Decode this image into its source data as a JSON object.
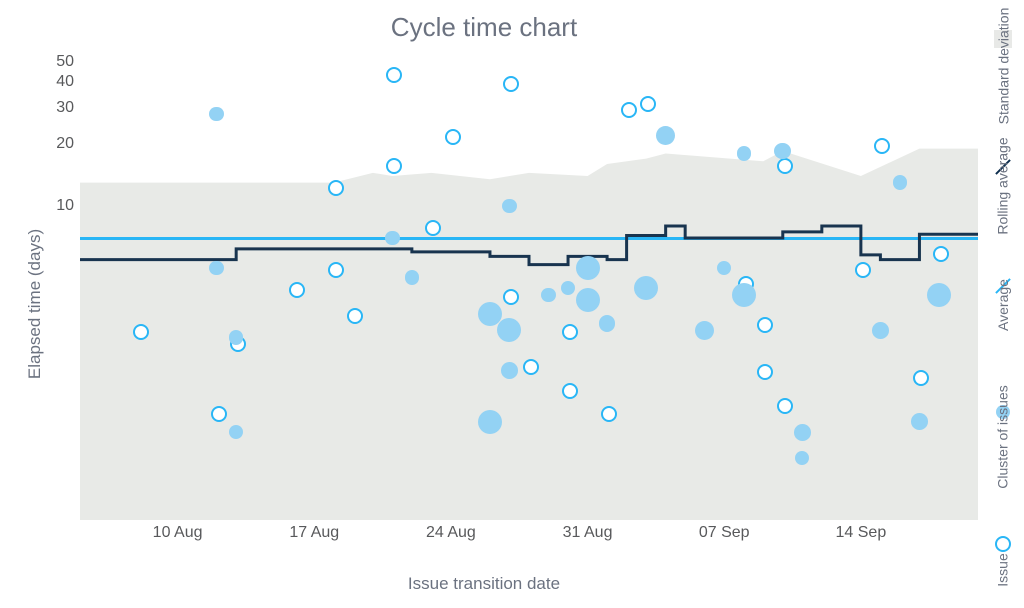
{
  "title": "Cycle time chart",
  "xlabel": "Issue transition date",
  "ylabel": "Elapsed time (days)",
  "legend": {
    "std": "Standard deviation",
    "ra": "Rolling average",
    "avg": "Average",
    "clu": "Cluster of issues",
    "iss": "Issue"
  },
  "x_ticks": [
    "10 Aug",
    "17 Aug",
    "24 Aug",
    "31 Aug",
    "07 Sep",
    "14 Sep"
  ],
  "y_ticks": [
    10,
    20,
    30,
    40,
    50
  ],
  "chart_data": {
    "type": "scatter",
    "title": "Cycle time chart",
    "xlabel": "Issue transition date",
    "ylabel": "Elapsed time (days)",
    "ylim": [
      0,
      50
    ],
    "x_domain": [
      "05 Aug",
      "20 Sep"
    ],
    "average": 7,
    "rolling_average": [
      {
        "x": "05 Aug",
        "y": 5.5
      },
      {
        "x": "12 Aug",
        "y": 5.5
      },
      {
        "x": "13 Aug",
        "y": 6.2
      },
      {
        "x": "22 Aug",
        "y": 6.0
      },
      {
        "x": "23 Aug",
        "y": 6.0
      },
      {
        "x": "26 Aug",
        "y": 5.7
      },
      {
        "x": "28 Aug",
        "y": 5.2
      },
      {
        "x": "30 Aug",
        "y": 5.7
      },
      {
        "x": "01 Sep",
        "y": 5.5
      },
      {
        "x": "02 Sep",
        "y": 7.2
      },
      {
        "x": "03 Sep",
        "y": 7.2
      },
      {
        "x": "04 Sep",
        "y": 8.0
      },
      {
        "x": "05 Sep",
        "y": 7.0
      },
      {
        "x": "10 Sep",
        "y": 7.5
      },
      {
        "x": "12 Sep",
        "y": 8.0
      },
      {
        "x": "14 Sep",
        "y": 5.8
      },
      {
        "x": "15 Sep",
        "y": 5.5
      },
      {
        "x": "17 Sep",
        "y": 7.3
      },
      {
        "x": "20 Sep",
        "y": 7.3
      }
    ],
    "std_band_upper": [
      {
        "x": "05 Aug",
        "y": 13
      },
      {
        "x": "18 Aug",
        "y": 13
      },
      {
        "x": "20 Aug",
        "y": 14.5
      },
      {
        "x": "21 Aug",
        "y": 14
      },
      {
        "x": "23 Aug",
        "y": 14.5
      },
      {
        "x": "26 Aug",
        "y": 13.5
      },
      {
        "x": "28 Aug",
        "y": 14.5
      },
      {
        "x": "31 Aug",
        "y": 14
      },
      {
        "x": "01 Sep",
        "y": 16
      },
      {
        "x": "03 Sep",
        "y": 17
      },
      {
        "x": "04 Sep",
        "y": 18
      },
      {
        "x": "09 Sep",
        "y": 16.5
      },
      {
        "x": "10 Sep",
        "y": 18.5
      },
      {
        "x": "14 Sep",
        "y": 14
      },
      {
        "x": "17 Sep",
        "y": 19
      },
      {
        "x": "20 Sep",
        "y": 19
      }
    ],
    "std_band_lower": 0,
    "series": [
      {
        "name": "Issue",
        "marker": "open",
        "points": [
          {
            "x": "08 Aug",
            "y": 2.5
          },
          {
            "x": "12 Aug",
            "y": 1.0
          },
          {
            "x": "13 Aug",
            "y": 2.2
          },
          {
            "x": "16 Aug",
            "y": 4.0
          },
          {
            "x": "18 Aug",
            "y": 12.5
          },
          {
            "x": "18 Aug",
            "y": 5.0
          },
          {
            "x": "19 Aug",
            "y": 3.0
          },
          {
            "x": "21 Aug",
            "y": 44
          },
          {
            "x": "21 Aug",
            "y": 16
          },
          {
            "x": "23 Aug",
            "y": 8.0
          },
          {
            "x": "24 Aug",
            "y": 22
          },
          {
            "x": "27 Aug",
            "y": 40
          },
          {
            "x": "27 Aug",
            "y": 3.7
          },
          {
            "x": "28 Aug",
            "y": 1.7
          },
          {
            "x": "30 Aug",
            "y": 2.5
          },
          {
            "x": "30 Aug",
            "y": 1.3
          },
          {
            "x": "01 Sep",
            "y": 1.0
          },
          {
            "x": "02 Sep",
            "y": 30
          },
          {
            "x": "03 Sep",
            "y": 4.0
          },
          {
            "x": "03 Sep",
            "y": 32
          },
          {
            "x": "08 Sep",
            "y": 4.3
          },
          {
            "x": "09 Sep",
            "y": 1.6
          },
          {
            "x": "09 Sep",
            "y": 2.7
          },
          {
            "x": "10 Sep",
            "y": 1.1
          },
          {
            "x": "10 Sep",
            "y": 16
          },
          {
            "x": "14 Sep",
            "y": 5
          },
          {
            "x": "15 Sep",
            "y": 20
          },
          {
            "x": "17 Sep",
            "y": 1.5
          },
          {
            "x": "18 Sep",
            "y": 6.0
          }
        ]
      },
      {
        "name": "Cluster of issues",
        "marker": "filled",
        "points": [
          {
            "x": "12 Aug",
            "y": 28,
            "size": 1.2
          },
          {
            "x": "12 Aug",
            "y": 5,
            "size": 1.2
          },
          {
            "x": "13 Aug",
            "y": 0.8,
            "size": 1.2
          },
          {
            "x": "13 Aug",
            "y": 2.3,
            "size": 1.2
          },
          {
            "x": "21 Aug",
            "y": 7,
            "size": 1.2
          },
          {
            "x": "22 Aug",
            "y": 4.5,
            "size": 1.2
          },
          {
            "x": "26 Aug",
            "y": 3,
            "size": 2.0
          },
          {
            "x": "26 Aug",
            "y": 0.9,
            "size": 2.0
          },
          {
            "x": "27 Aug",
            "y": 2.5,
            "size": 2.0
          },
          {
            "x": "27 Aug",
            "y": 1.6,
            "size": 1.4
          },
          {
            "x": "27 Aug",
            "y": 10,
            "size": 1.2
          },
          {
            "x": "29 Aug",
            "y": 3.7,
            "size": 1.2
          },
          {
            "x": "30 Aug",
            "y": 4.0,
            "size": 1.2
          },
          {
            "x": "31 Aug",
            "y": 3.5,
            "size": 2.0
          },
          {
            "x": "31 Aug",
            "y": 5.0,
            "size": 2.0
          },
          {
            "x": "01 Sep",
            "y": 2.7,
            "size": 1.4
          },
          {
            "x": "03 Sep",
            "y": 4.0,
            "size": 2.0
          },
          {
            "x": "04 Sep",
            "y": 22,
            "size": 1.6
          },
          {
            "x": "06 Sep",
            "y": 2.5,
            "size": 1.6
          },
          {
            "x": "07 Sep",
            "y": 5,
            "size": 1.2
          },
          {
            "x": "08 Sep",
            "y": 3.7,
            "size": 2.0
          },
          {
            "x": "08 Sep",
            "y": 18,
            "size": 1.2
          },
          {
            "x": "10 Sep",
            "y": 18.5,
            "size": 1.4
          },
          {
            "x": "11 Sep",
            "y": 0.8,
            "size": 1.4
          },
          {
            "x": "11 Sep",
            "y": 0.6,
            "size": 1.2
          },
          {
            "x": "15 Sep",
            "y": 2.5,
            "size": 1.4
          },
          {
            "x": "16 Sep",
            "y": 13,
            "size": 1.2
          },
          {
            "x": "17 Sep",
            "y": 0.9,
            "size": 1.4
          },
          {
            "x": "18 Sep",
            "y": 3.7,
            "size": 2.0
          }
        ]
      }
    ]
  }
}
